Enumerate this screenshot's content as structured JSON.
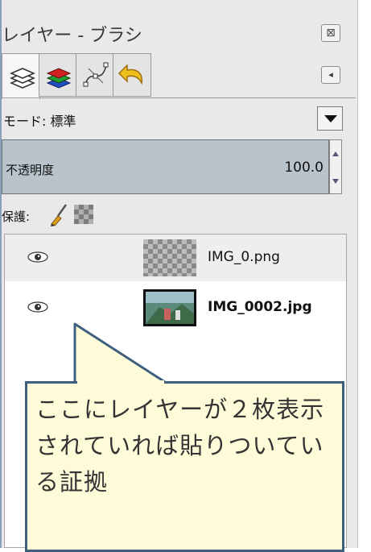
{
  "window": {
    "title": "レイヤー - ブラシ",
    "close_glyph": "⊠",
    "tab_menu_glyph": "◂"
  },
  "tabs": [
    {
      "name": "layers",
      "icon": "layers-stack-icon",
      "active": true
    },
    {
      "name": "channels",
      "icon": "channels-icon",
      "active": false
    },
    {
      "name": "paths",
      "icon": "paths-icon",
      "active": false
    },
    {
      "name": "undo-history",
      "icon": "undo-arrow-icon",
      "active": false
    }
  ],
  "mode": {
    "label": "モード: 標準"
  },
  "opacity": {
    "label": "不透明度",
    "value": "100.0"
  },
  "protect": {
    "label": "保護:"
  },
  "layers": [
    {
      "name": "IMG_0.png",
      "thumbnail": "transparent-checker",
      "visible": true,
      "bold": false
    },
    {
      "name": "IMG_0002.jpg",
      "thumbnail": "photo",
      "visible": true,
      "bold": true
    }
  ],
  "callout": {
    "text": "ここにレイヤーが２枚表示されていれば貼りついている証拠"
  },
  "colors": {
    "callout_bg": "#fefbd8",
    "callout_border": "#3f5f7f",
    "opacity_bar": "#b8c3cb"
  }
}
